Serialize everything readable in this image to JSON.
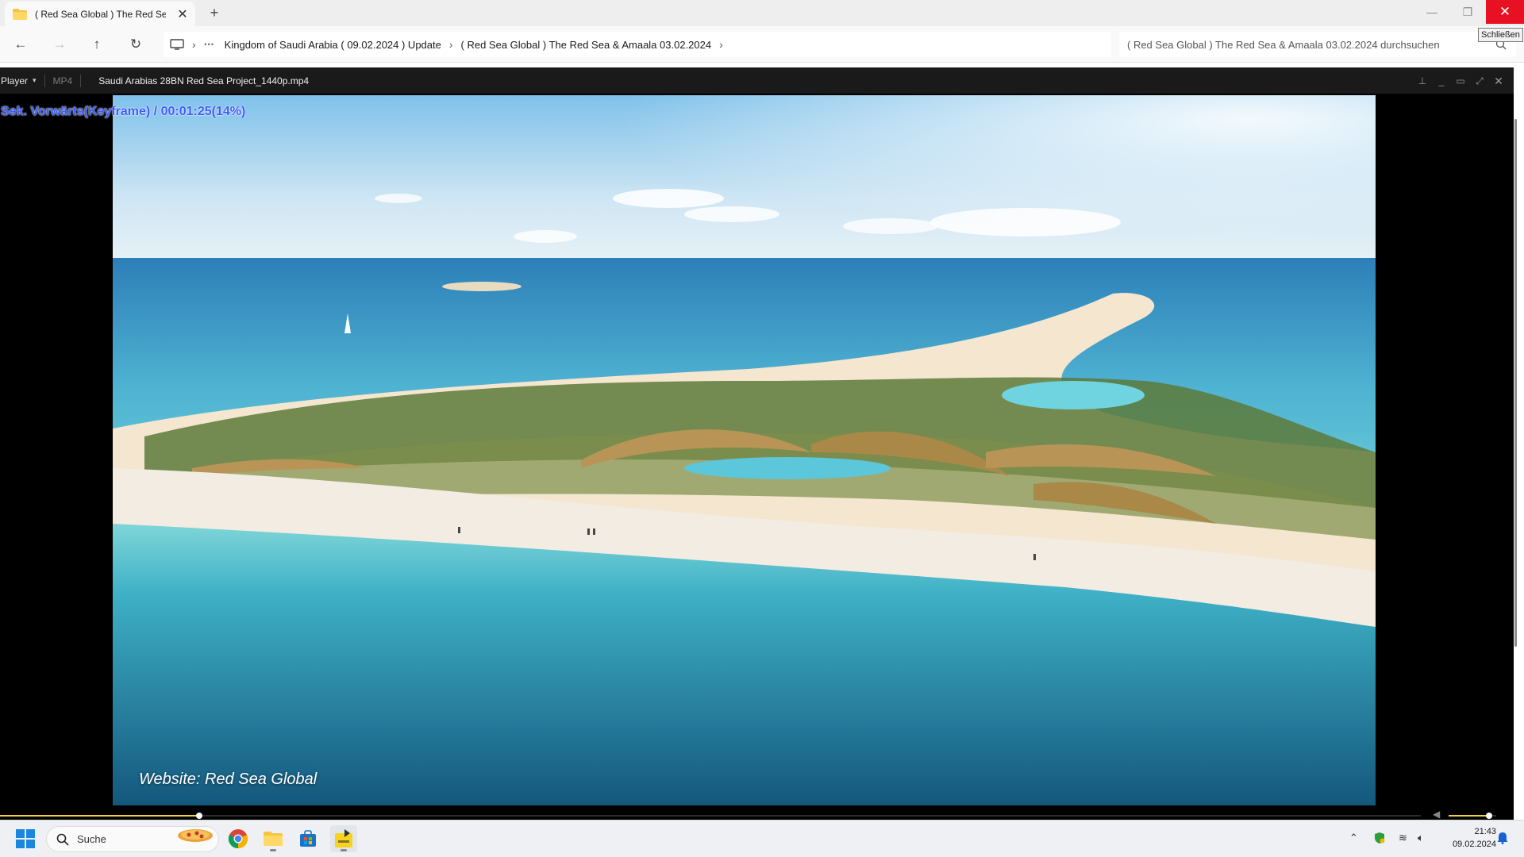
{
  "window": {
    "tab_title": "( Red Sea Global ) The Red Sea & Amaala 03.02.2024",
    "new_tab_symbol": "+",
    "close_tooltip": "Schließen"
  },
  "nav": {
    "breadcrumbs": [
      "Kingdom of Saudi Arabia ( 09.02.2024 ) Update",
      "( Red Sea Global ) The Red Sea & Amaala 03.02.2024"
    ],
    "search_placeholder": "( Red Sea Global ) The Red Sea & Amaala 03.02.2024 durchsuchen"
  },
  "player": {
    "menu_label": "Player",
    "format": "MP4",
    "file_name": "Saudi Arabias 28BN Red Sea Project_1440p.mp4",
    "osd_text": "Sek. Vorwärts(Keyframe) / 00:01:25(14%)",
    "watermark": "Website: Red Sea Global",
    "progress_fraction": 0.14,
    "volume_fraction": 0.85,
    "accent_color": "#f2d33a"
  },
  "taskbar": {
    "search_label": "Suche",
    "pinned_apps": [
      "chrome-icon",
      "file-explorer-icon",
      "store-icon",
      "player-icon"
    ],
    "time": "21:43",
    "date": "09.02.2024"
  }
}
